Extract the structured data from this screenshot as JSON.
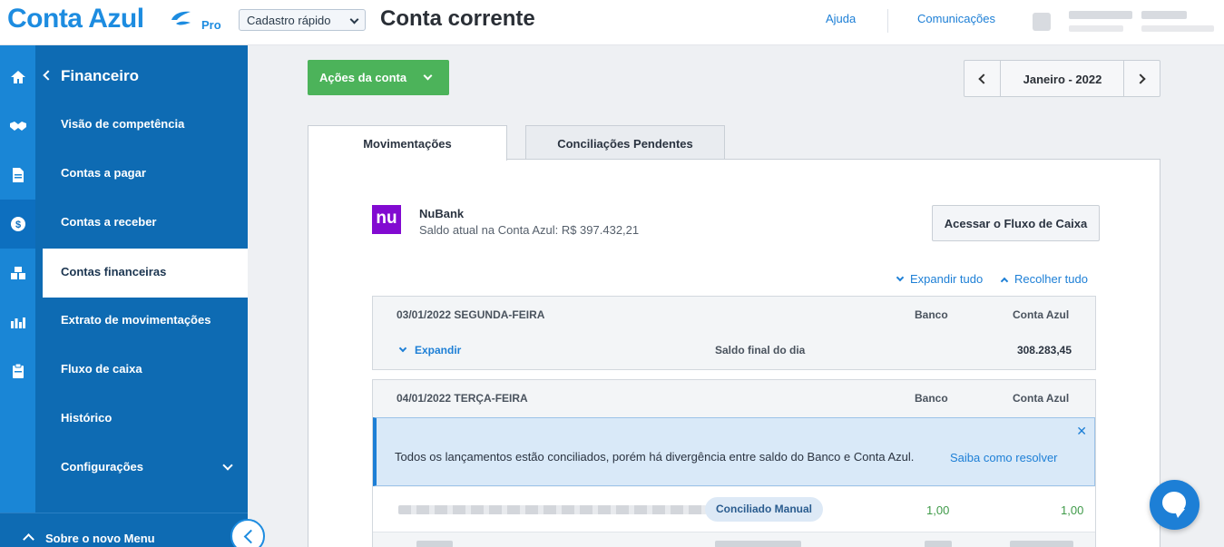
{
  "header": {
    "logo_text": "Conta Azul",
    "logo_badge": "Pro",
    "quick_register": "Cadastro rápido",
    "page_title": "Conta corrente",
    "help": "Ajuda",
    "communications": "Comunicações"
  },
  "sidebar": {
    "section_title": "Financeiro",
    "items": [
      {
        "label": "Visão de competência"
      },
      {
        "label": "Contas a pagar"
      },
      {
        "label": "Contas a receber"
      },
      {
        "label": "Contas financeiras"
      },
      {
        "label": "Extrato de movimentações"
      },
      {
        "label": "Fluxo de caixa"
      },
      {
        "label": "Histórico"
      },
      {
        "label": "Configurações"
      }
    ],
    "active_item": "Contas financeiras",
    "bottom_label": "Sobre o novo Menu",
    "rail_icons": [
      "home-icon",
      "handshake-icon",
      "document-icon",
      "dollar-icon",
      "boxes-icon",
      "chart-icon",
      "clipboard-icon"
    ]
  },
  "toolbar": {
    "account_actions": "Ações da conta",
    "period": "Janeiro - 2022"
  },
  "tabs": [
    {
      "label": "Movimentações",
      "active": true
    },
    {
      "label": "Conciliações Pendentes",
      "active": false
    }
  ],
  "account": {
    "logo_text": "nu",
    "name": "NuBank",
    "balance_text": "Saldo atual na Conta Azul: R$ 397.432,21",
    "cashflow_button": "Acessar o Fluxo de Caixa",
    "expand_all": "Expandir tudo",
    "collapse_all": "Recolher tudo"
  },
  "days": [
    {
      "date": "03/01/2022 SEGUNDA-FEIRA",
      "col_bank": "Banco",
      "col_conta_azul": "Conta Azul",
      "expand": "Expandir",
      "end_balance_label": "Saldo final do dia",
      "end_balance_value": "308.283,45"
    },
    {
      "date": "04/01/2022 TERÇA-FEIRA",
      "col_bank": "Banco",
      "col_conta_azul": "Conta Azul",
      "alert_message": "Todos os lançamentos estão conciliados, porém há divergência entre saldo do Banco e Conta Azul.",
      "alert_link": "Saiba como resolver",
      "transactions": [
        {
          "tag": "Conciliado Manual",
          "bank_value": "1,00",
          "conta_azul_value": "1,00"
        }
      ]
    }
  ],
  "colors": {
    "brand": "#1d8ce0",
    "sidebar": "#0e6bb3",
    "action_green": "#4cb35a",
    "nubank": "#820ad1",
    "positive_value": "#3f9a49"
  }
}
